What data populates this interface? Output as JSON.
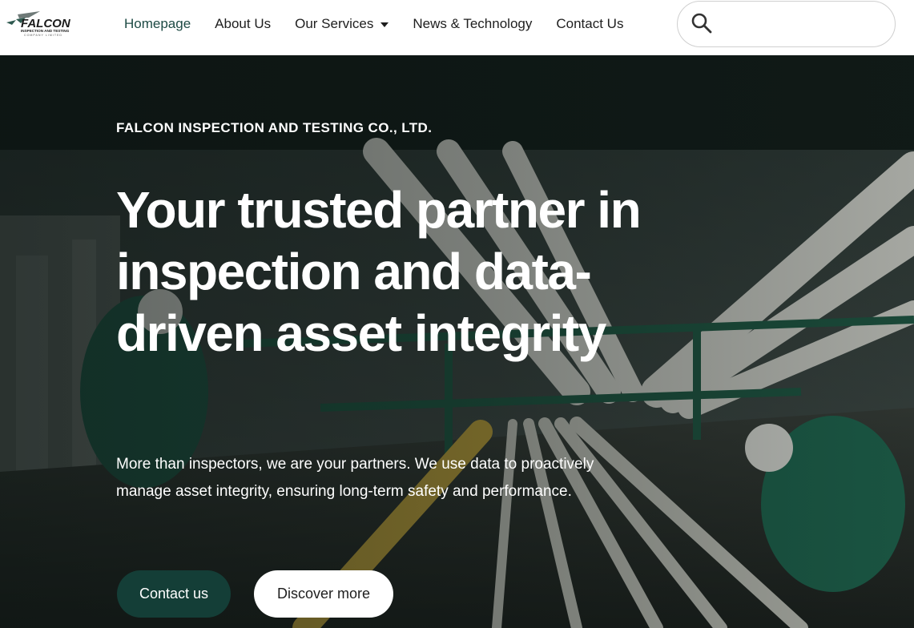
{
  "brand": {
    "name": "FALCON",
    "tagline": "INSPECTION AND TESTING",
    "tagline2": "COMPANY LIMITED",
    "accent_color": "#143e37"
  },
  "nav": {
    "items": [
      {
        "label": "Homepage",
        "active": true
      },
      {
        "label": "About Us"
      },
      {
        "label": "Our Services",
        "icon": "chevron-down-icon"
      },
      {
        "label": "News & Technology"
      },
      {
        "label": "Contact Us"
      }
    ]
  },
  "search": {
    "icon": "search-icon",
    "value": "",
    "placeholder": ""
  },
  "hero": {
    "eyebrow": "FALCON INSPECTION AND TESTING CO., LTD.",
    "headline": "Your trusted partner in inspection and data-driven asset integrity",
    "lead": "More than inspectors, we are your partners. We use data to proactively manage asset integrity, ensuring long-term safety and performance.",
    "primary_button": "Contact us",
    "secondary_button": "Discover more"
  }
}
